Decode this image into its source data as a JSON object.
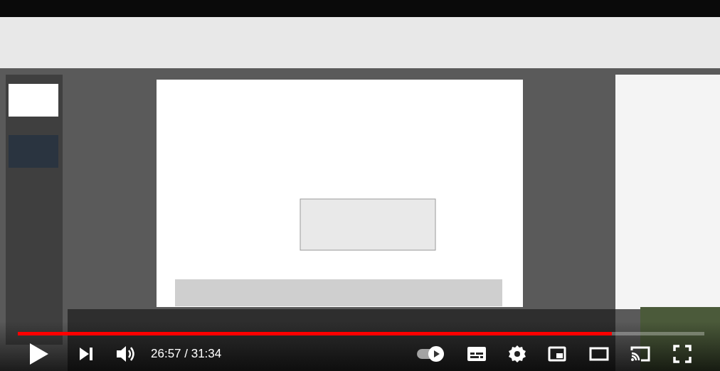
{
  "player": {
    "progress": {
      "level": 0.865
    },
    "time": "26:57 / 31:34",
    "autoplay": {
      "on": true
    }
  }
}
